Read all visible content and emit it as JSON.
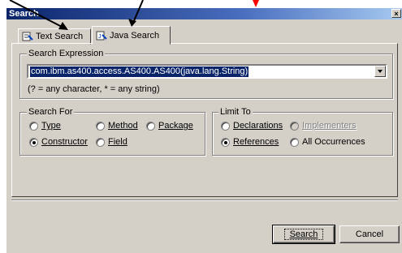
{
  "window": {
    "title": "Search",
    "close_glyph": "×"
  },
  "tabs": [
    {
      "label": "Text Search",
      "icon": "text-search-icon"
    },
    {
      "label": "Java Search",
      "icon": "java-search-icon"
    }
  ],
  "search_expression": {
    "legend": "Search Expression",
    "value": "com.ibm.as400.access.AS400.AS400(java.lang.String)",
    "hint": "(? = any character, * = any string)"
  },
  "search_for": {
    "legend": "Search For",
    "options": [
      "Type",
      "Method",
      "Package",
      "Constructor",
      "Field"
    ],
    "selected": "Constructor"
  },
  "limit_to": {
    "legend": "Limit To",
    "options": [
      "Declarations",
      "Implementers",
      "References",
      "All Occurrences"
    ],
    "selected": "References",
    "disabled": [
      "Implementers"
    ]
  },
  "buttons": {
    "search": "Search",
    "cancel": "Cancel"
  },
  "colors": {
    "title_bar": "#0a246a",
    "selection": "#0a246a",
    "face": "#d4d0c8",
    "annotation_arrow": "#000000",
    "annotation_mark": "#ff0000"
  }
}
